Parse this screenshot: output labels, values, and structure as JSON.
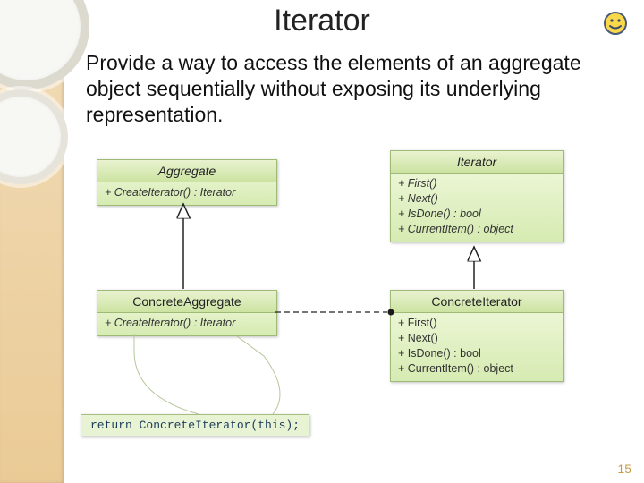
{
  "slide": {
    "title": "Iterator",
    "smiley_emoji": "smiley-icon",
    "description": "Provide a way to access the elements of an aggregate object sequentially without exposing its underlying representation.",
    "page_number": "15"
  },
  "classes": {
    "aggregate": {
      "name": "Aggregate",
      "ops": [
        "+ CreateIterator() : Iterator"
      ],
      "abstract": true
    },
    "iterator": {
      "name": "Iterator",
      "ops": [
        "+ First()",
        "+ Next()",
        "+ IsDone() : bool",
        "+ CurrentItem() : object"
      ],
      "abstract": true
    },
    "concrete_aggregate": {
      "name": "ConcreteAggregate",
      "ops": [
        "+ CreateIterator() : Iterator"
      ],
      "abstract": false
    },
    "concrete_iterator": {
      "name": "ConcreteIterator",
      "ops": [
        "+ First()",
        "+ Next()",
        "+ IsDone() : bool",
        "+ CurrentItem() : object"
      ],
      "abstract": false
    }
  },
  "note": {
    "text": "return ConcreteIterator(this);"
  },
  "relationships": [
    {
      "from": "ConcreteAggregate",
      "to": "Aggregate",
      "kind": "generalization"
    },
    {
      "from": "ConcreteIterator",
      "to": "Iterator",
      "kind": "generalization"
    },
    {
      "from": "ConcreteAggregate",
      "to": "ConcreteIterator",
      "kind": "dependency-create"
    },
    {
      "from": "note",
      "to": "ConcreteAggregate.CreateIterator",
      "kind": "note-link"
    }
  ]
}
